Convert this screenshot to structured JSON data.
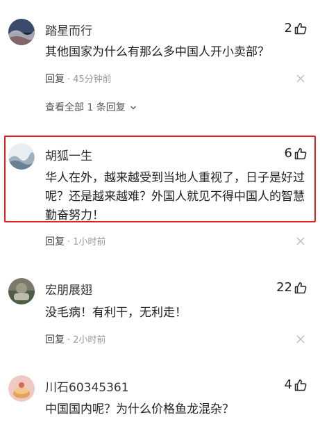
{
  "comments": [
    {
      "name": "踏星而行",
      "likes": "2",
      "text": "其他国家为什么有那么多中国人开小卖部？",
      "reply_label": "回复",
      "time": "45分钟前",
      "expand": "查看全部 1 条回复"
    },
    {
      "name": "胡狐一生",
      "likes": "6",
      "text": "华人在外，越来越受到当地人重视了，日子是好过呢？还是越来越难？外国人就见不得中国人的智慧勤奋努力！",
      "reply_label": "回复",
      "time": "1小时前"
    },
    {
      "name": "宏朋展翅",
      "likes": "22",
      "text": "没毛病！有利干，无利走！",
      "reply_label": "回复",
      "time": "2小时前"
    },
    {
      "name": "川石60345361",
      "likes": "4",
      "text": "中国国内呢？为什么价格鱼龙混杂？"
    }
  ],
  "colors": {
    "highlight_border": "#e02020",
    "meta_text": "#999999"
  }
}
